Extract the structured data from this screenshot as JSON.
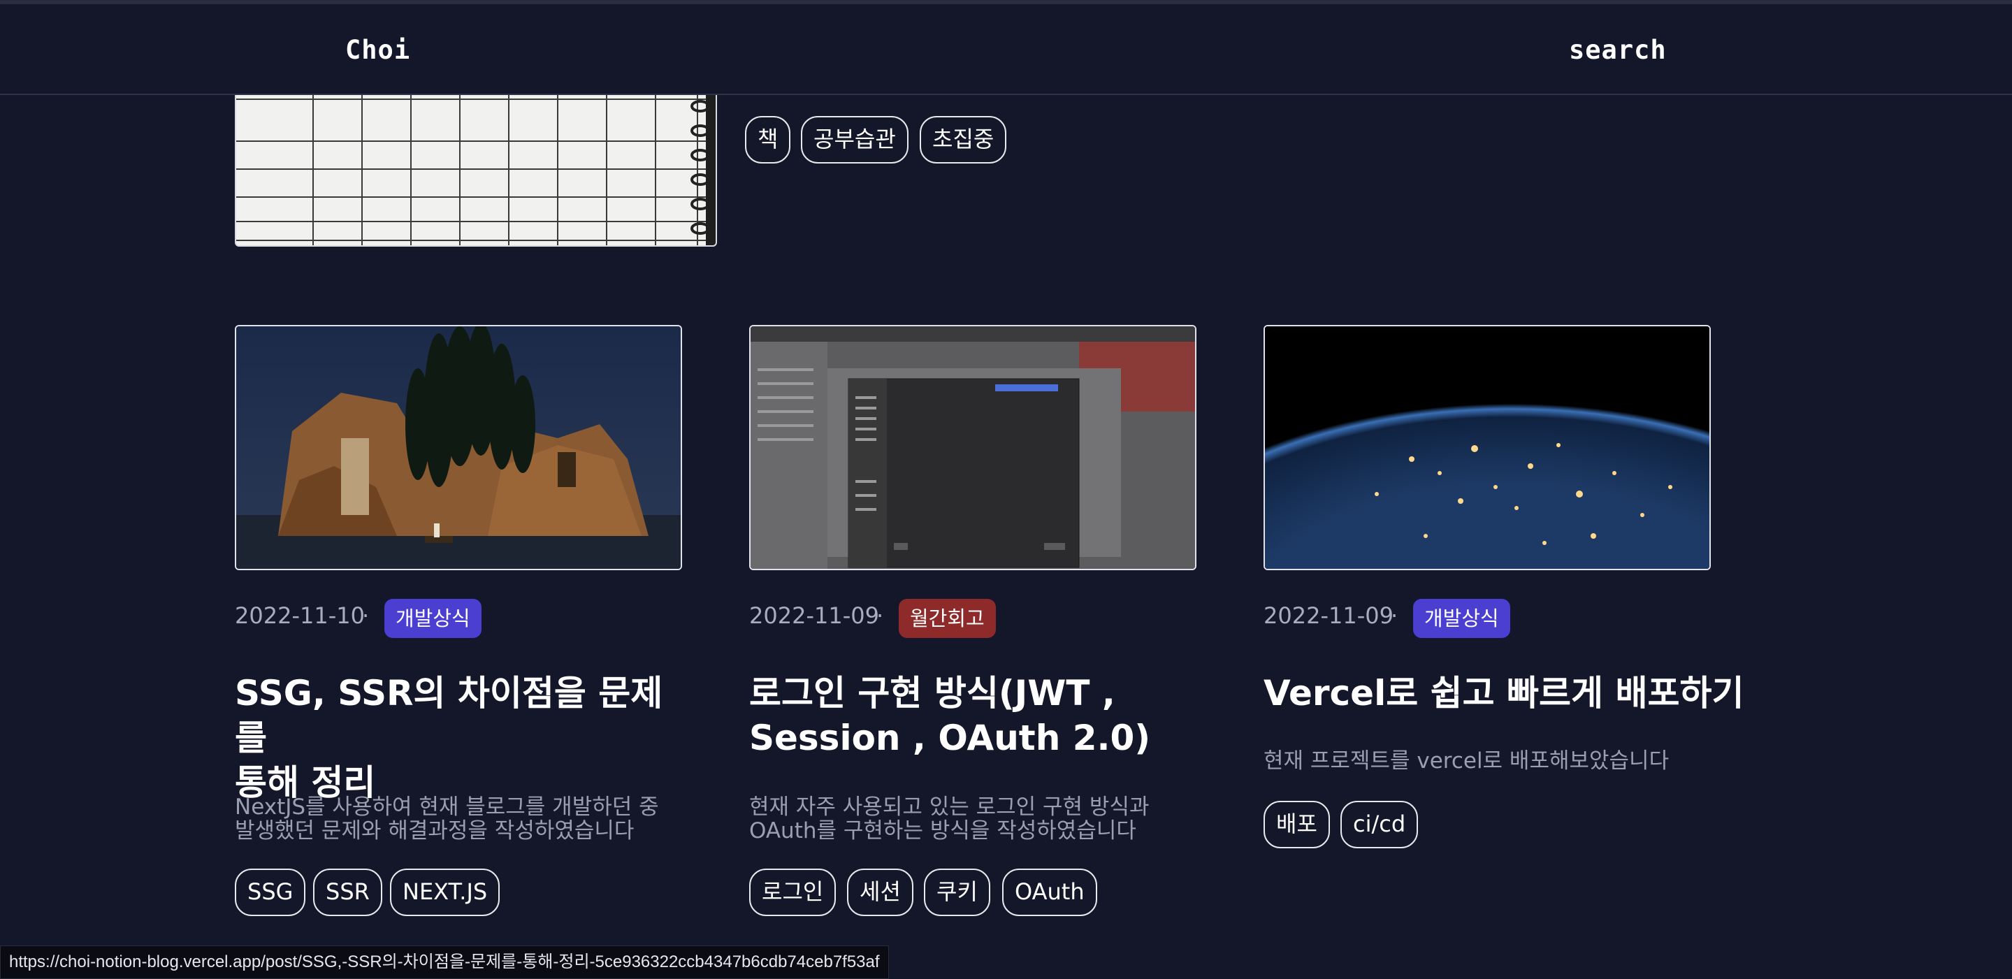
{
  "header": {
    "logo": "Choi",
    "search": "search"
  },
  "top_card": {
    "tags": [
      "책",
      "공부습관",
      "초집중"
    ]
  },
  "cards": [
    {
      "date": "2022-11-10",
      "category": "개발상식",
      "category_color": "#4a3fd1",
      "title_line1": "SSG, SSR의 차이점을 문제를",
      "title_line2": "통해 정리",
      "desc_line1": "NextJS를 사용하여 현재 블로그를 개발하던 중",
      "desc_line2": "발생했던 문제와 해결과정을 작성하였습니다",
      "tags": [
        "SSG",
        "SSR",
        "NEXT.JS"
      ]
    },
    {
      "date": "2022-11-09",
      "category": "월간회고",
      "category_color": "#8e2a2a",
      "title_line1": "로그인 구현 방식(JWT ,",
      "title_line2": "Session , OAuth 2.0)",
      "desc_line1": "현재 자주 사용되고 있는 로그인 구현 방식과",
      "desc_line2": "OAuth를 구현하는 방식을 작성하였습니다",
      "tags": [
        "로그인",
        "세션",
        "쿠키",
        "OAuth"
      ]
    },
    {
      "date": "2022-11-09",
      "category": "개발상식",
      "category_color": "#4a3fd1",
      "title_line1": "Vercel로 쉽고 빠르게 배포하기",
      "desc_line1": "현재 프로젝트를 vercel로 배포해보았습니다",
      "tags": [
        "배포",
        "ci/cd"
      ]
    }
  ],
  "meta_separator": "·",
  "status_url": "https://choi-notion-blog.vercel.app/post/SSG,-SSR의-차이점을-문제를-통해-정리-5ce936322ccb4347b6cdb74ceb7f53af"
}
